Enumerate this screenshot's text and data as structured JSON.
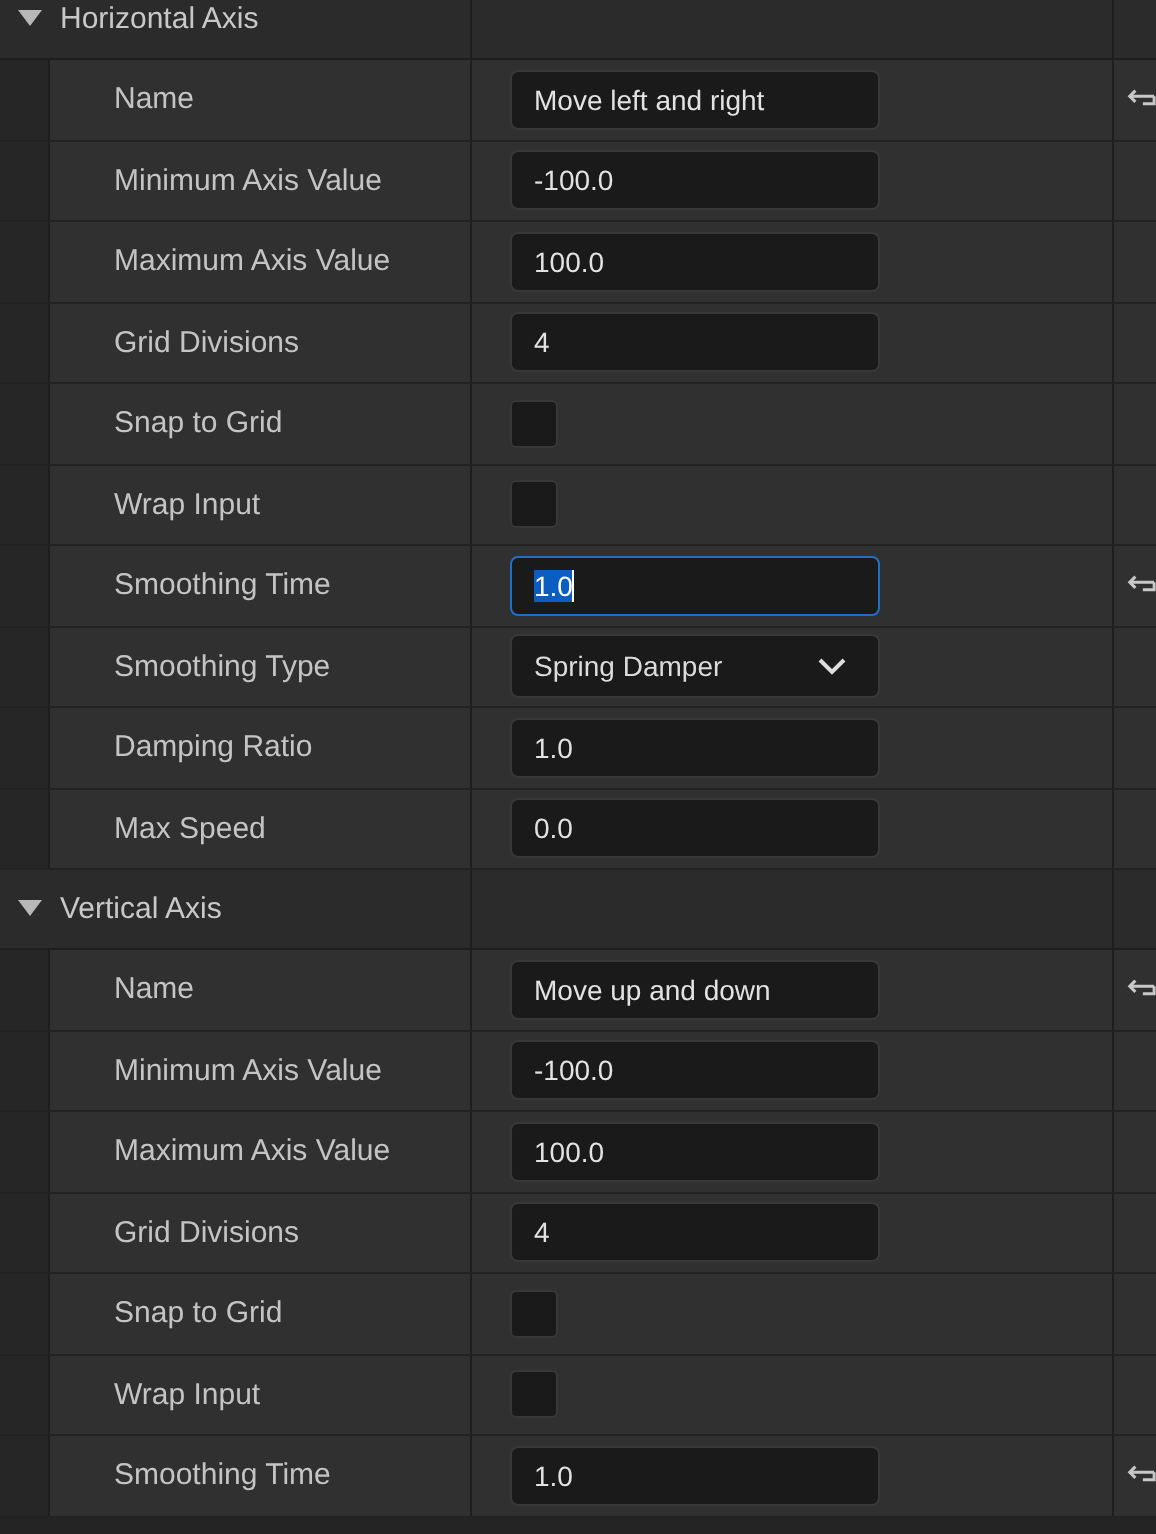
{
  "sections": [
    {
      "title": "Horizontal Axis",
      "expanded": true,
      "rows": [
        {
          "label": "Name",
          "kind": "text",
          "value": "Move left and right",
          "focused": false,
          "reset": true
        },
        {
          "label": "Minimum Axis Value",
          "kind": "text",
          "value": "-100.0",
          "focused": false,
          "reset": false
        },
        {
          "label": "Maximum Axis Value",
          "kind": "text",
          "value": "100.0",
          "focused": false,
          "reset": false
        },
        {
          "label": "Grid Divisions",
          "kind": "text",
          "value": "4",
          "focused": false,
          "reset": false
        },
        {
          "label": "Snap to Grid",
          "kind": "checkbox",
          "checked": false,
          "reset": false
        },
        {
          "label": "Wrap Input",
          "kind": "checkbox",
          "checked": false,
          "reset": false
        },
        {
          "label": "Smoothing Time",
          "kind": "text",
          "value": "1.0",
          "focused": true,
          "reset": true
        },
        {
          "label": "Smoothing Type",
          "kind": "dropdown",
          "value": "Spring Damper",
          "reset": false
        },
        {
          "label": "Damping Ratio",
          "kind": "text",
          "value": "1.0",
          "focused": false,
          "reset": false
        },
        {
          "label": "Max Speed",
          "kind": "text",
          "value": "0.0",
          "focused": false,
          "reset": false
        }
      ]
    },
    {
      "title": "Vertical Axis",
      "expanded": true,
      "rows": [
        {
          "label": "Name",
          "kind": "text",
          "value": "Move up and down",
          "focused": false,
          "reset": true
        },
        {
          "label": "Minimum Axis Value",
          "kind": "text",
          "value": "-100.0",
          "focused": false,
          "reset": false
        },
        {
          "label": "Maximum Axis Value",
          "kind": "text",
          "value": "100.0",
          "focused": false,
          "reset": false
        },
        {
          "label": "Grid Divisions",
          "kind": "text",
          "value": "4",
          "focused": false,
          "reset": false
        },
        {
          "label": "Snap to Grid",
          "kind": "checkbox",
          "checked": false,
          "reset": false
        },
        {
          "label": "Wrap Input",
          "kind": "checkbox",
          "checked": false,
          "reset": false
        },
        {
          "label": "Smoothing Time",
          "kind": "text",
          "value": "1.0",
          "focused": false,
          "reset": true
        }
      ]
    }
  ]
}
